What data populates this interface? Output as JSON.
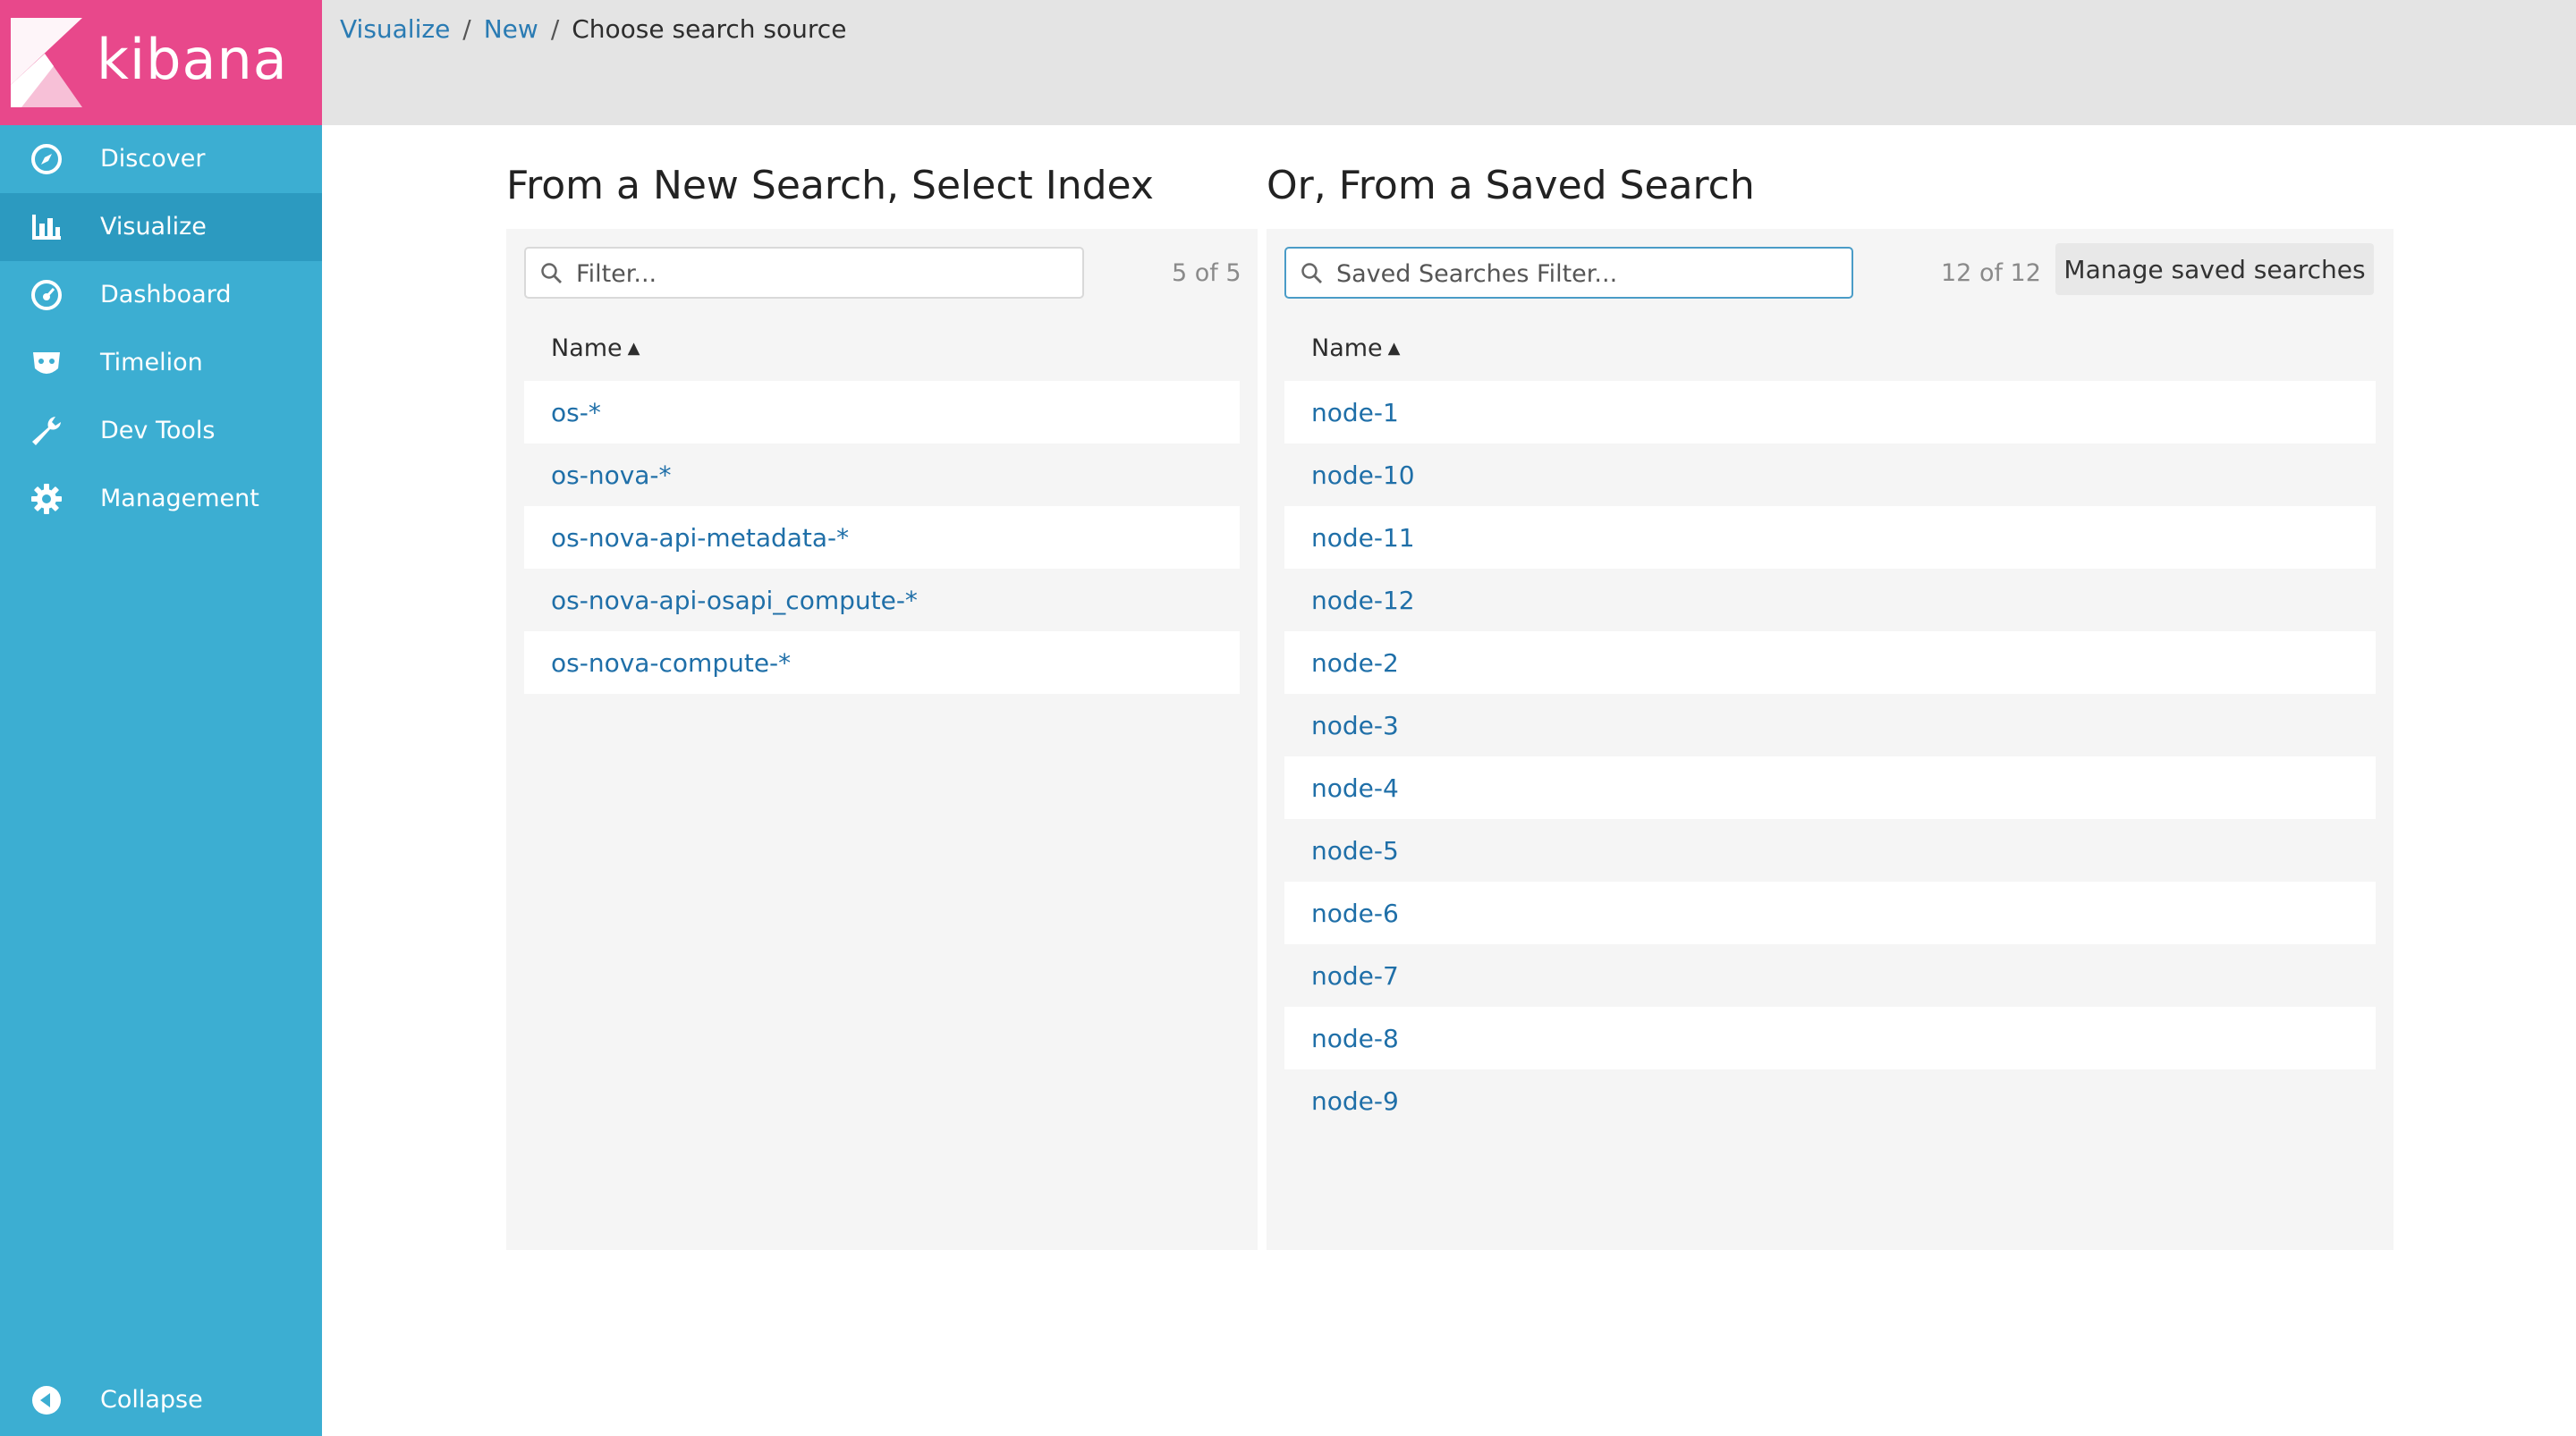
{
  "app": {
    "name": "kibana"
  },
  "sidebar": {
    "items": [
      {
        "label": "Discover",
        "icon": "compass-icon",
        "active": false
      },
      {
        "label": "Visualize",
        "icon": "bar-chart-icon",
        "active": true
      },
      {
        "label": "Dashboard",
        "icon": "dashboard-icon",
        "active": false
      },
      {
        "label": "Timelion",
        "icon": "timelion-icon",
        "active": false
      },
      {
        "label": "Dev Tools",
        "icon": "wrench-icon",
        "active": false
      },
      {
        "label": "Management",
        "icon": "gear-icon",
        "active": false
      }
    ],
    "collapse_label": "Collapse"
  },
  "breadcrumb": {
    "items": [
      "Visualize",
      "New"
    ],
    "separator": "/",
    "current": "Choose search source"
  },
  "new_search": {
    "title": "From a New Search, Select Index",
    "filter_placeholder": "Filter...",
    "count": "5 of 5",
    "column_header": "Name",
    "rows": [
      "os-*",
      "os-nova-*",
      "os-nova-api-metadata-*",
      "os-nova-api-osapi_compute-*",
      "os-nova-compute-*"
    ]
  },
  "saved_search": {
    "title": "Or, From a Saved Search",
    "filter_placeholder": "Saved Searches Filter...",
    "count": "12 of 12",
    "manage_label": "Manage saved searches",
    "column_header": "Name",
    "rows": [
      "node-1",
      "node-10",
      "node-11",
      "node-12",
      "node-2",
      "node-3",
      "node-4",
      "node-5",
      "node-6",
      "node-7",
      "node-8",
      "node-9"
    ]
  },
  "colors": {
    "sidebar": "#3caed2",
    "sidebar_active": "#2c9ac0",
    "logo_bg": "#e8488b",
    "link": "#1f6fa8",
    "topbar": "#e4e4e4"
  }
}
